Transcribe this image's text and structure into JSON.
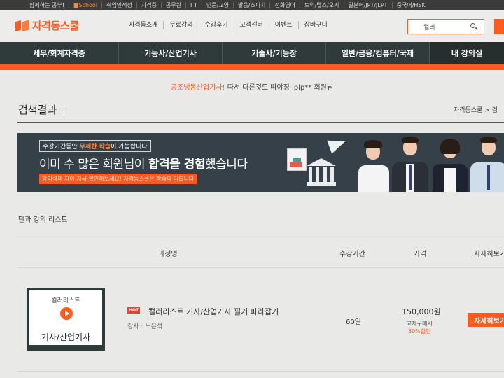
{
  "topbar": {
    "links": [
      "함께하는 공부!",
      "■School",
      "취업인적성",
      "자격증",
      "공무원",
      "I T",
      "인문/교양",
      "발음/스피치",
      "전화영어",
      "토익/텝스/오픽",
      "일본어/JPT/JLPT",
      "중국어/HSK"
    ]
  },
  "header": {
    "logo_text": "자격동스쿨",
    "nav": [
      "자격동소개",
      "무료강의",
      "수강후기",
      "고객센터",
      "이벤트",
      "장바구니"
    ],
    "search_value": "컬러"
  },
  "category_nav": [
    "세무/회계자격증",
    "기능사/산업기사",
    "기술사/기능장",
    "일반/금융/컴퓨터/국제",
    "내 강의실"
  ],
  "welcome": {
    "highlight": "공조냉동산업기사!",
    "text": " 따서 다른것도 따야징 lplp** 회원님"
  },
  "page": {
    "title": "검색결과",
    "breadcrumb": "자격동스쿨 > 검"
  },
  "banner": {
    "line1_pre": "수강기간동안 ",
    "line1_hl": "무제한 학습",
    "line1_post": "이 가능합니다",
    "line2_pre": "이미 수 많은 회원님이 ",
    "line2_bold": "합격을 경험",
    "line2_post": "했습니다",
    "line3": "강의력의 차이 지금 확인해보세요! 자격동스쿨은 학습의 다릅니다"
  },
  "list": {
    "title": "단과 강의 리스트",
    "headers": {
      "course": "과정명",
      "period": "수강기간",
      "price": "가격",
      "detail": "자세히보기"
    },
    "rows": [
      {
        "thumb_label": "컬러리스트",
        "thumb_category": "기사/산업기사",
        "badge": "HOT",
        "title": "컬러리스트 기사/산업기사 필기 파라잡기",
        "teacher": "강사 : 노은석",
        "period": "60일",
        "price": "150,000원",
        "note1": "교재구매시",
        "note2": "30%할인",
        "button": "자세히보기"
      }
    ]
  },
  "colors": {
    "accent": "#ff5a1f",
    "nav_bg": "#2f3b3a",
    "banner_bg": "#354048"
  }
}
